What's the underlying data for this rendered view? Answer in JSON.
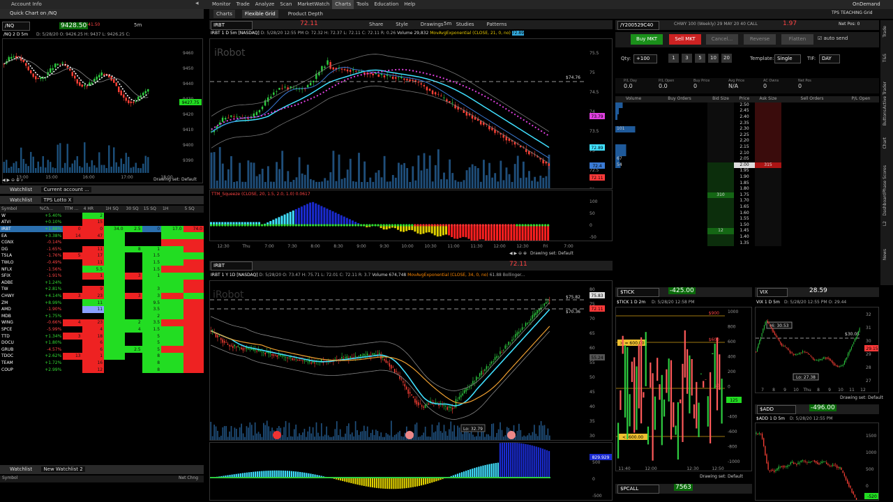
{
  "top": {
    "account_info": "Account Info",
    "menu": [
      "Monitor",
      "Trade",
      "Analyze",
      "Scan",
      "MarketWatch",
      "Charts",
      "Tools",
      "Education",
      "Help"
    ],
    "active_menu": "Charts",
    "brand": "thinkorswim",
    "on_demand": "OnDemand"
  },
  "subtabs": [
    "Charts",
    "Flexible Grid",
    "Product Depth"
  ],
  "quick_chart": {
    "title": "Quick Chart on /NQ",
    "symbol": "/NQ",
    "price": "9428.50",
    "chg": "-41.50",
    "interval": "5m",
    "desc": "/NQ 2 D 5m",
    "ohlc": "D: 5/28/20 O: 9426.25 H: 9437 L: 9426.25 C:",
    "price_tag": "9427.75",
    "yticks": [
      "9460",
      "9450",
      "9440",
      "9430",
      "9420",
      "9410",
      "9400",
      "9390"
    ],
    "xticks": [
      "13:00",
      "15:00",
      "16:00",
      "17:00",
      "18:00"
    ],
    "drawing_set": "Drawing set: Default"
  },
  "watchlist1": {
    "title": "Watchlist",
    "name": "Current account ...",
    "sub_title": "Watchlist",
    "list": "TPS Lotto X",
    "cols": [
      "Symbol",
      "%Ch...",
      "TTM ...",
      "4 HR",
      "1H SQ",
      "30 SQ",
      "15 SQ",
      "1H",
      "5 SQ"
    ],
    "rows": [
      [
        "W",
        "+5.40%",
        "",
        "2",
        "",
        "",
        "",
        "",
        ""
      ],
      [
        "ATVI",
        "+0.10%",
        "",
        "15",
        "",
        "",
        "",
        "",
        ""
      ],
      [
        "IRBT",
        "+1.88%",
        "0",
        "0",
        "34.0",
        "2.5",
        "0",
        "17.0",
        "74.0"
      ],
      [
        "EA",
        "+3.38%",
        "14",
        "47",
        "",
        "",
        "",
        "",
        ""
      ],
      [
        "CGNX",
        "-0.14%",
        "",
        "",
        "",
        "",
        "",
        "",
        ""
      ],
      [
        "DG",
        "-1.65%",
        "",
        "11",
        "",
        "8",
        "1",
        "",
        ""
      ],
      [
        "TSLA",
        "-1.76%",
        "5",
        "17",
        "",
        "",
        "1.5",
        "",
        ""
      ],
      [
        "TWLO",
        "-0.49%",
        "",
        "11",
        "",
        "",
        "1.5",
        "",
        ""
      ],
      [
        "NFLX",
        "-1.56%",
        "",
        "5.5",
        "",
        "",
        "1.5",
        "",
        ""
      ],
      [
        "SFIX",
        "-1.91%",
        "",
        "1",
        "",
        "3",
        "1",
        "",
        ""
      ],
      [
        "ADBE",
        "+1.24%",
        "",
        "",
        "",
        "",
        "",
        "",
        ""
      ],
      [
        "TW",
        "+2.81%",
        "",
        "9",
        "",
        "",
        "3",
        "",
        ""
      ],
      [
        "CHWY",
        "+4.14%",
        "3",
        "23",
        "",
        "3",
        "3",
        "",
        ""
      ],
      [
        "ZM",
        "+8.99%",
        "",
        "11",
        "",
        "",
        "9.5",
        "",
        ""
      ],
      [
        "AMD",
        "-1.90%",
        "",
        "11",
        "",
        "",
        "3.5",
        "",
        ""
      ],
      [
        "MDB",
        "+1.75%",
        "",
        "",
        "",
        "",
        "2",
        "",
        ""
      ],
      [
        "WING",
        "-0.66%",
        "4",
        "23",
        "",
        "2",
        "3.5",
        "",
        ""
      ],
      [
        "SPCE",
        "-5.99%",
        "",
        "4",
        "",
        "4",
        "1.5",
        "",
        ""
      ],
      [
        "TTD",
        "+1.34%",
        "3",
        "18",
        "",
        "",
        "5",
        "",
        ""
      ],
      [
        "DOCU",
        "+1.80%",
        "",
        "6",
        "",
        "",
        "5",
        "",
        ""
      ],
      [
        "GRUB",
        "-4.57%",
        "",
        "6",
        "",
        "2.5",
        "5",
        "",
        ""
      ],
      [
        "TDOC",
        "+2.62%",
        "13",
        "1",
        "",
        "",
        "8",
        "",
        ""
      ],
      [
        "TEAM",
        "+1.72%",
        "",
        "16",
        "",
        "",
        "8",
        "",
        ""
      ],
      [
        "COUP",
        "+2.99%",
        "",
        "12",
        "",
        "",
        "8",
        "",
        ""
      ]
    ]
  },
  "watchlist2": {
    "title": "Watchlist",
    "name": "New Watchlist 2",
    "col1": "Symbol",
    "col2": "Net Chng"
  },
  "chart1": {
    "symbol": "IRBT",
    "price": "72.11",
    "interval": "5m",
    "desc": "IRBT 1 D 5m [NASDAQ]",
    "ohlc": "D: 5/28/20 12:55 PM O: 72.32 H: 72.37 L: 72.11 C: 72.11 R: 0.26",
    "volume": "Volume 29,832",
    "study": "MovAvgExponential (CLOSE, 21, 0, no)",
    "study_val": "72.89",
    "watermark": "iRobot",
    "line_label": "$74.76",
    "yticks": [
      "75.5",
      "75",
      "74.5",
      "74",
      "73.5",
      "73",
      "72.5",
      "72"
    ],
    "tags": [
      "73.79",
      "72.89",
      "72.4",
      "72.11"
    ],
    "xticks": [
      "12:30",
      "Thu",
      "7:00",
      "7:30",
      "8:00",
      "8:30",
      "9:00",
      "9:30",
      "10:00",
      "10:30",
      "11:00",
      "11:30",
      "12:00",
      "12:30",
      "Fri",
      "7:00"
    ],
    "sq_label": "TTM_Squeeze (CLOSE, 20, 1.5, 2.0, 1.0)",
    "sq_val": "0.0617",
    "sq_ticks": [
      "100",
      "50",
      "0",
      "-50"
    ],
    "drawing_set": "Drawing set: Default",
    "toolbar": [
      "Share",
      "Style",
      "Drawings",
      "Studies",
      "Patterns"
    ]
  },
  "chart2": {
    "symbol": "IRBT",
    "price": "72.11",
    "desc": "IRBT 1 Y 1D [NASDAQ]",
    "ohlc": "D: 5/28/20 O: 73.47 H: 75.71 L: 72.01 C: 72.11 R: 3.7",
    "volume": "Volume 674,748",
    "study": "MovAvgExponential (CLOSE, 34, 0, no)",
    "study_val": "61.88",
    "study2": "Bollinger...",
    "watermark": "iRobot",
    "lo_label": "Lo: 32.79",
    "line1": "$75.82",
    "line2": "$70.36",
    "yticks": [
      "80",
      "75",
      "70",
      "65",
      "60",
      "55",
      "50",
      "45",
      "40",
      "35",
      "30"
    ],
    "tags": [
      "75.83",
      "72.11",
      "55.24"
    ],
    "osc_tag": "829.929",
    "osc_ticks": [
      "500",
      "0",
      "-500"
    ]
  },
  "trade": {
    "symbol": "/Y200529C40",
    "desc": "CHWY 100 (Weekly) 29 MAY 20 40 CALL",
    "price": "1.97",
    "grid": "TPS TEACHING Grid",
    "buy": "Buy MKT",
    "sell": "Sell MKT",
    "cancel": "Cancel...",
    "reverse": "Reverse",
    "flatten": "Flatten",
    "auto_send": "auto send",
    "qty_label": "Qty:",
    "qty": "+100",
    "qty_btns": [
      "1",
      "3",
      "5",
      "10",
      "20"
    ],
    "template_label": "Template:",
    "template": "Single",
    "tif_label": "TIF:",
    "tif": "DAY",
    "stats": [
      [
        "P/L Day",
        "0.0"
      ],
      [
        "P/L Open",
        "0.0"
      ],
      [
        "Buy Price",
        "0"
      ],
      [
        "Avg Price",
        "N/A"
      ],
      [
        "AC Owns",
        "0"
      ],
      [
        "Net Pos",
        "0"
      ]
    ],
    "net_pos": "Net Pos: 0",
    "cols": [
      "Volume",
      "Buy Orders",
      "Bid Size",
      "Price",
      "Ask Size",
      "Sell Orders",
      "P/L Open"
    ],
    "prices": [
      "2.50",
      "2.45",
      "2.40",
      "2.35",
      "2.30",
      "2.25",
      "2.20",
      "2.15",
      "2.10",
      "2.05",
      "2.00",
      "1.95",
      "1.90",
      "1.85",
      "1.80",
      "1.75",
      "1.70",
      "1.65",
      "1.60",
      "1.55",
      "1.50",
      "1.45",
      "1.40",
      "1.35"
    ],
    "vol_101": "101",
    "vol_67": "67",
    "vol_54": "54",
    "ask_315": "315",
    "bid_310": "310",
    "bid_12": "12"
  },
  "side_tabs": [
    "Trade",
    "T&S",
    "Active Trader",
    "Buttons",
    "Chart",
    "Phase Scores",
    "Dashboard",
    "L2",
    "News"
  ],
  "tick": {
    "symbol": "$TICK",
    "price": "-425.00",
    "desc": "$TICK 1 D 2m",
    "ohlc": "D: 5/28/20 12:58 PM",
    "lines": [
      "$900",
      "$600",
      "$0"
    ],
    "labels": [
      "> = 600.00",
      "< -600.00"
    ],
    "yticks": [
      "1000",
      "800",
      "600",
      "400",
      "200",
      "0",
      "-200",
      "-400",
      "-600",
      "-800",
      "-1000"
    ],
    "xticks": [
      "11:40",
      "12:00",
      "12:30",
      "12:50"
    ],
    "tag": "125",
    "drawing_set": "Drawing set: Default"
  },
  "vix": {
    "symbol": "VIX",
    "price": "28.59",
    "desc": "VIX 1 D 5m",
    "ohlc": "D: 5/28/20 12:55 PM O: 29.44",
    "hi": "Hi: 30.53",
    "lo": "Lo: 27.38",
    "line": "$30.05",
    "yticks": [
      "32",
      "31",
      "30",
      "29",
      "28",
      "27"
    ],
    "xticks": [
      "7",
      "8",
      "9",
      "10",
      "Thu",
      "8",
      "9",
      "10",
      "11",
      "12"
    ],
    "tag": "29.15",
    "drawing_set": "Drawing set: Default"
  },
  "add": {
    "symbol": "$ADD",
    "price": "-496.00",
    "desc": "$ADD 1 D 5m",
    "ohlc": "D: 5/28/20 12:55 PM",
    "yticks": [
      "1500",
      "1000",
      "500",
      "0"
    ],
    "tag": "-520"
  },
  "pcall": {
    "symbol": "$PCALL",
    "price": "7563"
  },
  "colors": {
    "green": "#00e000",
    "red": "#ff3a3a",
    "cyan": "#40e0ff",
    "bg": "#000000"
  }
}
